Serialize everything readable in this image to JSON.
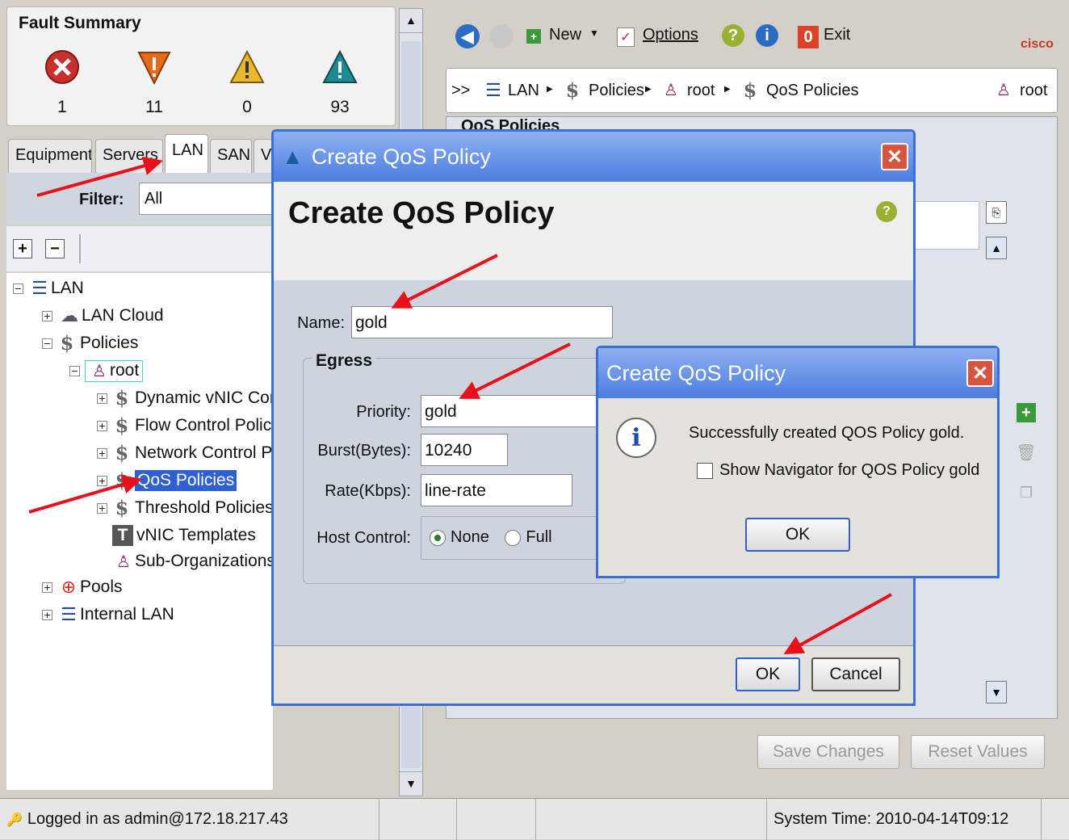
{
  "fault_summary": {
    "title": "Fault Summary",
    "items": [
      {
        "icon": "critical-icon",
        "count": "1"
      },
      {
        "icon": "major-icon",
        "count": "11"
      },
      {
        "icon": "minor-icon",
        "count": "0"
      },
      {
        "icon": "warning-icon",
        "count": "93"
      }
    ]
  },
  "nav_tabs": [
    "Equipment",
    "Servers",
    "LAN",
    "SAN",
    "VM"
  ],
  "active_tab": "LAN",
  "filter": {
    "label": "Filter:",
    "value": "All"
  },
  "tree": [
    {
      "label": "LAN",
      "level": 0,
      "icon": "lan-icon",
      "expander": "−"
    },
    {
      "label": "LAN Cloud",
      "level": 1,
      "icon": "cloud-icon",
      "expander": "+"
    },
    {
      "label": "Policies",
      "level": 1,
      "icon": "policy-icon",
      "expander": "−"
    },
    {
      "label": "root",
      "level": 2,
      "icon": "org-icon",
      "expander": "−"
    },
    {
      "label": "Dynamic vNIC Con",
      "level": 3,
      "icon": "policy-icon",
      "expander": "+"
    },
    {
      "label": "Flow Control Polici",
      "level": 3,
      "icon": "policy-icon",
      "expander": "+"
    },
    {
      "label": "Network Control P",
      "level": 3,
      "icon": "policy-icon",
      "expander": "+"
    },
    {
      "label": "QoS Policies",
      "level": 3,
      "icon": "policy-icon",
      "expander": "+",
      "selected": true
    },
    {
      "label": "Threshold Policies",
      "level": 3,
      "icon": "policy-icon",
      "expander": "+"
    },
    {
      "label": "vNIC Templates",
      "level": 3,
      "icon": "template-icon",
      "expander": ""
    },
    {
      "label": "Sub-Organizations",
      "level": 3,
      "icon": "org-icon",
      "expander": ""
    },
    {
      "label": "Pools",
      "level": 1,
      "icon": "pools-icon",
      "expander": "+"
    },
    {
      "label": "Internal LAN",
      "level": 1,
      "icon": "lan-icon",
      "expander": "+"
    }
  ],
  "toolbar": {
    "new_label": "New",
    "options_label": "Options",
    "exit_label": "Exit",
    "brand": "cisco"
  },
  "breadcrumb": {
    "prefix": ">>",
    "items": [
      "LAN",
      "Policies",
      "root",
      "QoS Policies"
    ],
    "right": "root"
  },
  "content_header": "QoS Policies",
  "right_buttons": {
    "save": "Save Changes",
    "reset": "Reset Values"
  },
  "dialog": {
    "window_title": "Create QoS Policy",
    "heading": "Create QoS Policy",
    "name_label": "Name:",
    "name_value": "gold",
    "egress_label": "Egress",
    "priority_label": "Priority:",
    "priority_value": "gold",
    "burst_label": "Burst(Bytes):",
    "burst_value": "10240",
    "rate_label": "Rate(Kbps):",
    "rate_value": "line-rate",
    "host_control_label": "Host Control:",
    "host_none": "None",
    "host_full": "Full",
    "host_selected": "None",
    "ok_label": "OK",
    "cancel_label": "Cancel"
  },
  "message": {
    "title": "Create QoS Policy",
    "text": "Successfully created QOS Policy gold.",
    "checkbox_label": "Show Navigator for QOS Policy gold",
    "ok_label": "OK"
  },
  "status_bar": {
    "login": "Logged in as admin@172.18.217.43",
    "system_time": "System Time: 2010-04-14T09:12"
  }
}
